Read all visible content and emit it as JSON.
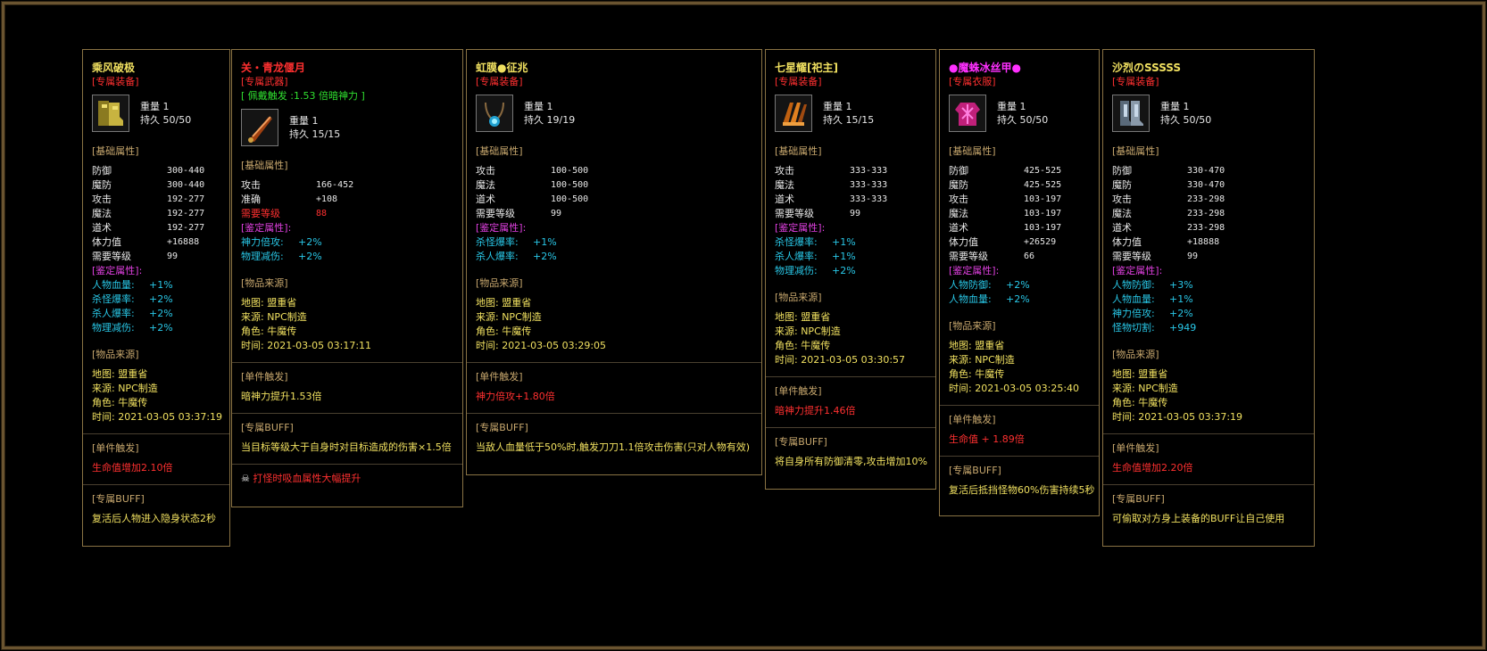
{
  "colors": {
    "border": "#8a7344",
    "section": "#c8a86e",
    "accent_red": "#ff3030",
    "cyan": "#29c8e8",
    "magenta": "#e040e0",
    "yellow": "#f0e060"
  },
  "cards": [
    {
      "title": "乘风破极",
      "tag": "[专属装备]",
      "icon": "boots-icon",
      "weight": "重量 1",
      "durability": "持久 50/50",
      "base_label": "[基础属性]",
      "stats": [
        [
          "防御",
          "300-440"
        ],
        [
          "魔防",
          "300-440"
        ],
        [
          "攻击",
          "192-277"
        ],
        [
          "魔法",
          "192-277"
        ],
        [
          "道术",
          "192-277"
        ],
        [
          "体力值",
          "+16888"
        ],
        [
          "需要等级",
          "99"
        ]
      ],
      "ident_label": "[鉴定属性]:",
      "ident": [
        [
          "人物血量:",
          "+1%"
        ],
        [
          "杀怪爆率:",
          "+2%"
        ],
        [
          "杀人爆率:",
          "+2%"
        ],
        [
          "物理减伤:",
          "+2%"
        ]
      ],
      "source_label": "[物品来源]",
      "source": [
        "地图: 盟重省",
        "来源: NPC制造",
        "角色: 牛魔传",
        "时间: 2021-03-05 03:37:19"
      ],
      "trigger_label": "[单件触发]",
      "trigger": "生命值增加2.10倍",
      "buff_label": "[专属BUFF]",
      "buff": "复活后人物进入隐身状态2秒"
    },
    {
      "title": "关・青龙偃月",
      "tag": "[专属武器]",
      "extra": "[ 佩戴触发 :1.53 倍暗神力 ]",
      "icon": "blade-icon",
      "weight": "重量 1",
      "durability": "持久 15/15",
      "base_label": "[基础属性]",
      "stats": [
        [
          "攻击",
          "166-452"
        ],
        [
          "准确",
          "+108"
        ],
        [
          "需要等级",
          "88"
        ]
      ],
      "ident_label": "[鉴定属性]:",
      "ident": [
        [
          "神力倍攻:",
          "+2%"
        ],
        [
          "物理减伤:",
          "+2%"
        ]
      ],
      "source_label": "[物品来源]",
      "source": [
        "地图: 盟重省",
        "来源: NPC制造",
        "角色: 牛魔传",
        "时间: 2021-03-05 03:17:11"
      ],
      "trigger_label": "[单件触发]",
      "trigger": "暗神力提升1.53倍",
      "buff_label": "[专属BUFF]",
      "buff": "当目标等级大于自身时对目标造成的伤害×1.5倍",
      "extra_line": "打怪时吸血属性大幅提升"
    },
    {
      "title": "虹膜●征兆",
      "tag": "[专属装备]",
      "icon": "necklace-icon",
      "weight": "重量 1",
      "durability": "持久 19/19",
      "base_label": "[基础属性]",
      "stats": [
        [
          "攻击",
          "100-500"
        ],
        [
          "魔法",
          "100-500"
        ],
        [
          "道术",
          "100-500"
        ],
        [
          "需要等级",
          "99"
        ]
      ],
      "ident_label": "[鉴定属性]:",
      "ident": [
        [
          "杀怪爆率:",
          "+1%"
        ],
        [
          "杀人爆率:",
          "+2%"
        ]
      ],
      "source_label": "[物品来源]",
      "source": [
        "地图: 盟重省",
        "来源: NPC制造",
        "角色: 牛魔传",
        "时间: 2021-03-05 03:29:05"
      ],
      "trigger_label": "[单件触发]",
      "trigger": "神力倍攻+1.80倍",
      "buff_label": "[专属BUFF]",
      "buff": "当敌人血量低于50%时,触发刀刀1.1倍攻击伤害(只对人物有效)"
    },
    {
      "title": "七星耀[祀主]",
      "tag": "[专属装备]",
      "icon": "gauntlet-icon",
      "weight": "重量 1",
      "durability": "持久 15/15",
      "base_label": "[基础属性]",
      "stats": [
        [
          "攻击",
          "333-333"
        ],
        [
          "魔法",
          "333-333"
        ],
        [
          "道术",
          "333-333"
        ],
        [
          "需要等级",
          "99"
        ]
      ],
      "ident_label": "[鉴定属性]:",
      "ident": [
        [
          "杀怪爆率:",
          "+1%"
        ],
        [
          "杀人爆率:",
          "+1%"
        ],
        [
          "物理减伤:",
          "+2%"
        ]
      ],
      "source_label": "[物品来源]",
      "source": [
        "地图: 盟重省",
        "来源: NPC制造",
        "角色: 牛魔传",
        "时间: 2021-03-05 03:30:57"
      ],
      "trigger_label": "[单件触发]",
      "trigger": "暗神力提升1.46倍",
      "buff_label": "[专属BUFF]",
      "buff": "将自身所有防御清零,攻击增加10%"
    },
    {
      "title": "●魔蛛冰丝甲●",
      "tag": "[专属衣服]",
      "icon": "armor-icon",
      "weight": "重量 1",
      "durability": "持久 50/50",
      "base_label": "[基础属性]",
      "stats": [
        [
          "防御",
          "425-525"
        ],
        [
          "魔防",
          "425-525"
        ],
        [
          "攻击",
          "103-197"
        ],
        [
          "魔法",
          "103-197"
        ],
        [
          "道术",
          "103-197"
        ],
        [
          "体力值",
          "+26529"
        ],
        [
          "需要等级",
          "66"
        ]
      ],
      "ident_label": "[鉴定属性]:",
      "ident": [
        [
          "人物防御:",
          "+2%"
        ],
        [
          "人物血量:",
          "+2%"
        ]
      ],
      "source_label": "[物品来源]",
      "source": [
        "地图: 盟重省",
        "来源: NPC制造",
        "角色: 牛魔传",
        "时间: 2021-03-05 03:25:40"
      ],
      "trigger_label": "[单件触发]",
      "trigger": "生命值 + 1.89倍",
      "buff_label": "[专属BUFF]",
      "buff": "复活后抵挡怪物60%伤害持续5秒"
    },
    {
      "title": "沙烈のSSSSS",
      "tag": "[专属装备]",
      "icon": "greaves-icon",
      "weight": "重量 1",
      "durability": "持久 50/50",
      "base_label": "[基础属性]",
      "stats": [
        [
          "防御",
          "330-470"
        ],
        [
          "魔防",
          "330-470"
        ],
        [
          "攻击",
          "233-298"
        ],
        [
          "魔法",
          "233-298"
        ],
        [
          "道术",
          "233-298"
        ],
        [
          "体力值",
          "+18888"
        ],
        [
          "需要等级",
          "99"
        ]
      ],
      "ident_label": "[鉴定属性]:",
      "ident": [
        [
          "人物防御:",
          "+3%"
        ],
        [
          "人物血量:",
          "+1%"
        ],
        [
          "神力倍攻:",
          "+2%"
        ],
        [
          "怪物切割:",
          "+949"
        ]
      ],
      "source_label": "[物品来源]",
      "source": [
        "地图: 盟重省",
        "来源: NPC制造",
        "角色: 牛魔传",
        "时间: 2021-03-05 03:37:19"
      ],
      "trigger_label": "[单件触发]",
      "trigger": "生命值增加2.20倍",
      "buff_label": "[专属BUFF]",
      "buff": "可偷取对方身上装备的BUFF让自己使用"
    }
  ]
}
